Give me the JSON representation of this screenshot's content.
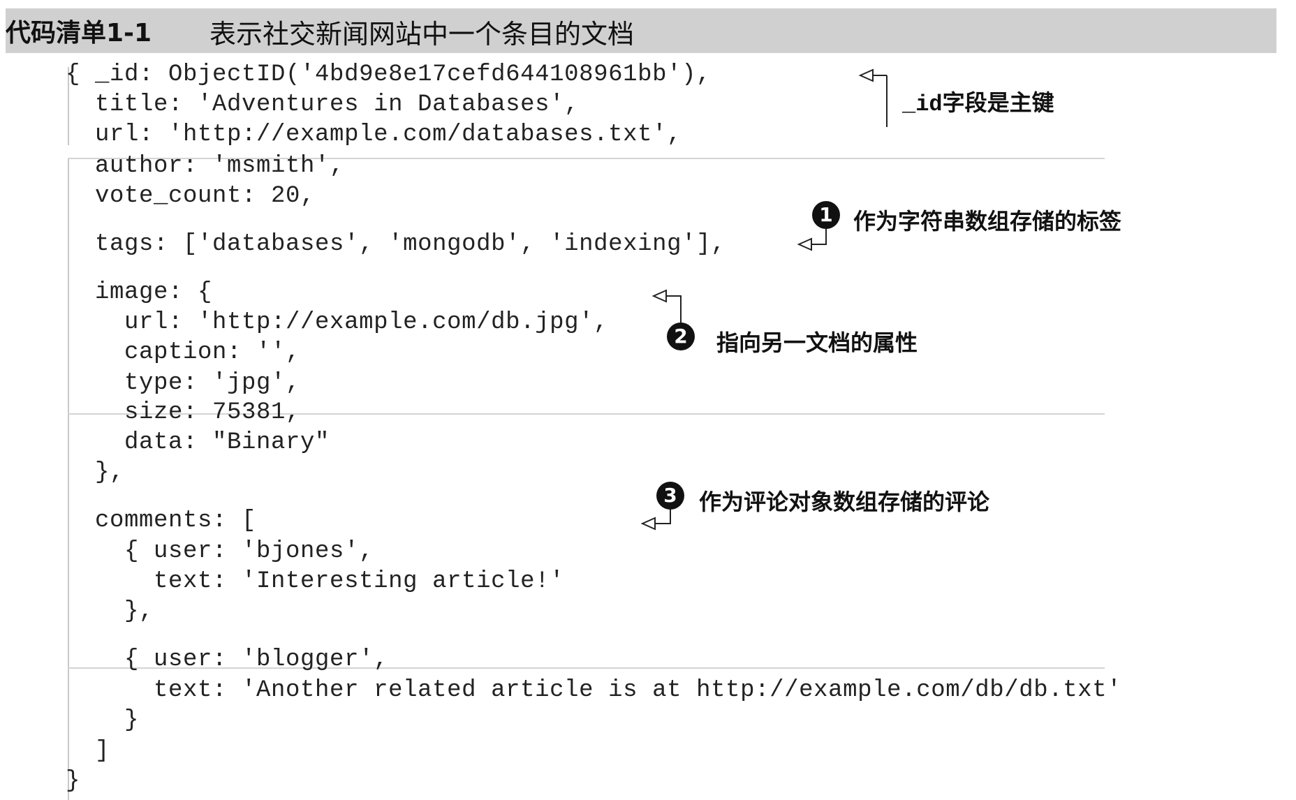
{
  "listing": {
    "number": "代码清单1-1",
    "title": "表示社交新闻网站中一个条目的文档"
  },
  "code_lines": [
    "{ _id: ObjectID('4bd9e8e17cefd644108961bb'),",
    "  title: 'Adventures in Databases',",
    "  url: 'http://example.com/databases.txt',",
    "  author: 'msmith',",
    "  vote_count: 20,",
    "  tags: ['databases', 'mongodb', 'indexing'],",
    "  image: {",
    "    url: 'http://example.com/db.jpg',",
    "    caption: '',",
    "    type: 'jpg',",
    "    size: 75381,",
    "    data: \"Binary\"",
    "  },",
    "  comments: [",
    "    { user: 'bjones',",
    "      text: 'Interesting article!'",
    "    },",
    "    { user: 'blogger',",
    "      text: 'Another related article is at http://example.com/db/db.txt'",
    "    }",
    "  ]",
    "}"
  ],
  "annotations": {
    "id_note": {
      "code_part": "_id",
      "text": "字段是主键"
    },
    "note1": {
      "marker": "1",
      "text": "作为字符串数组存储的标签"
    },
    "note2": {
      "marker": "2",
      "text": "指向另一文档的属性"
    },
    "note3": {
      "marker": "3",
      "text": "作为评论对象数组存储的评论"
    }
  }
}
